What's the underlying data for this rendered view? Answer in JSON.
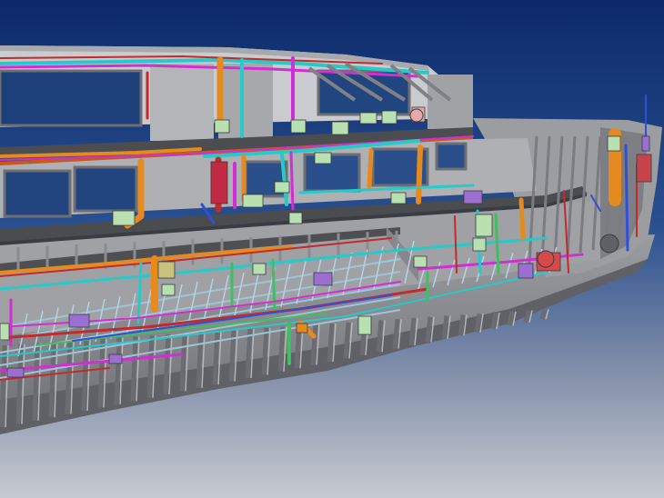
{
  "scene": {
    "subject": "",
    "colors": {
      "sky_top": "#0c2a6b",
      "sky_bottom": "#b9bfc9",
      "hull": "#8d8f93",
      "hull_dark": "#6e7075",
      "deck": "#4a4c50",
      "frame": "#a9abaf",
      "pipe_orange": "#e58a1f",
      "pipe_cyan": "#27c9c9",
      "pipe_magenta": "#d12fd1",
      "pipe_red": "#c42a2a",
      "pipe_green": "#3fbf5f",
      "pipe_blue": "#3050d8",
      "equipment_green": "#b9e0b0",
      "equipment_purple": "#9a6fd0"
    }
  }
}
